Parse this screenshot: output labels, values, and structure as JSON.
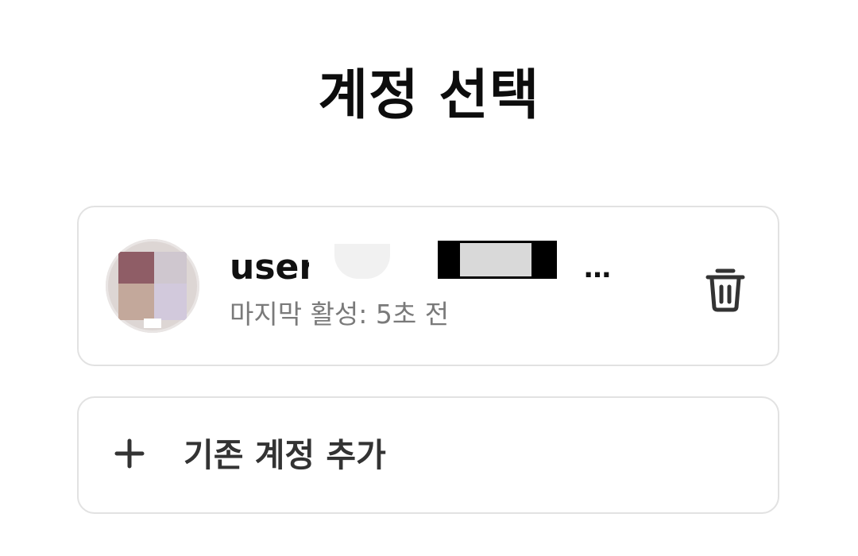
{
  "header": {
    "title": "계정 선택"
  },
  "account": {
    "name": "user",
    "name_truncation": "…",
    "last_active": "마지막 활성: 5초 전",
    "avatar_icon": "avatar",
    "delete_icon": "trash-icon"
  },
  "add_account": {
    "icon": "plus-icon",
    "label": "기존 계정 추가"
  },
  "colors": {
    "background": "#ffffff",
    "border": "#e2e2e2",
    "title_text": "#0d0d0d",
    "secondary_text": "#7a7a7a",
    "icon": "#333333"
  }
}
